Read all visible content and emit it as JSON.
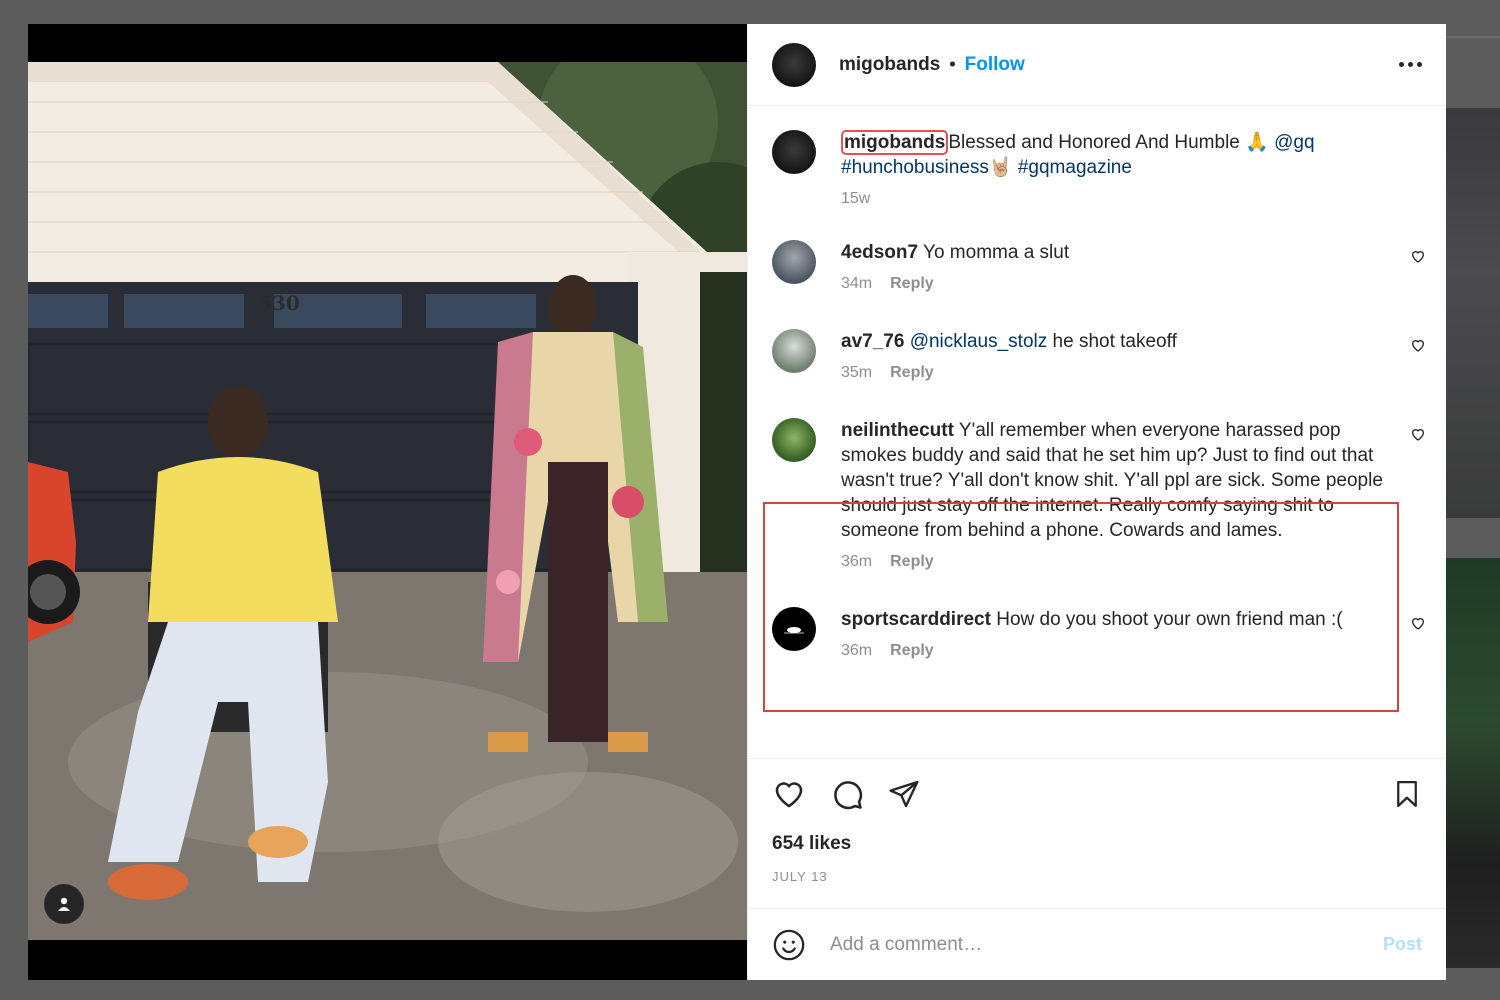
{
  "post": {
    "username": "migobands",
    "separator": "•",
    "follow_label": "Follow",
    "house_number": "530",
    "photo_subject": "photo",
    "caption": {
      "username": "migobands",
      "text": "Blessed and Honored And Humble 🙏 ",
      "mention": "@gq",
      "hashtag1": "#hunchobusiness",
      "emoji2": "🤘🏼",
      "hashtag2": "#gqmagazine",
      "age": "15w"
    },
    "likes": "654 likes",
    "date": "JULY 13"
  },
  "comments": [
    {
      "username": "4edson7",
      "text": "Yo momma a slut",
      "mention": "",
      "time": "34m",
      "reply_label": "Reply"
    },
    {
      "username": "av7_76",
      "mention": "@nicklaus_stolz",
      "text": " he shot takeoff",
      "time": "35m",
      "reply_label": "Reply"
    },
    {
      "username": "neilinthecutt",
      "mention": "",
      "text": "Y'all remember when everyone harassed pop smokes buddy and said that he set him up? Just to find out that wasn't true? Y'all don't know shit. Y'all ppl are sick. Some people should just stay off the internet. Really comfy saying shit to someone from behind a phone. Cowards and lames.",
      "time": "36m",
      "reply_label": "Reply"
    },
    {
      "username": "sportscarddirect",
      "mention": "",
      "text": "How do you shoot your own friend man :(",
      "time": "36m",
      "reply_label": "Reply"
    }
  ],
  "add_comment": {
    "placeholder": "Add a comment…",
    "post_label": "Post"
  },
  "icons": {
    "like": "heart-icon",
    "comment": "comment-icon",
    "share": "send-icon",
    "save": "bookmark-icon",
    "emoji": "emoji-icon",
    "more": "more-icon",
    "user_tag": "user-icon"
  },
  "colors": {
    "accent": "#0095f6",
    "highlight": "#d9433c",
    "post_disabled": "#b2dffc"
  }
}
